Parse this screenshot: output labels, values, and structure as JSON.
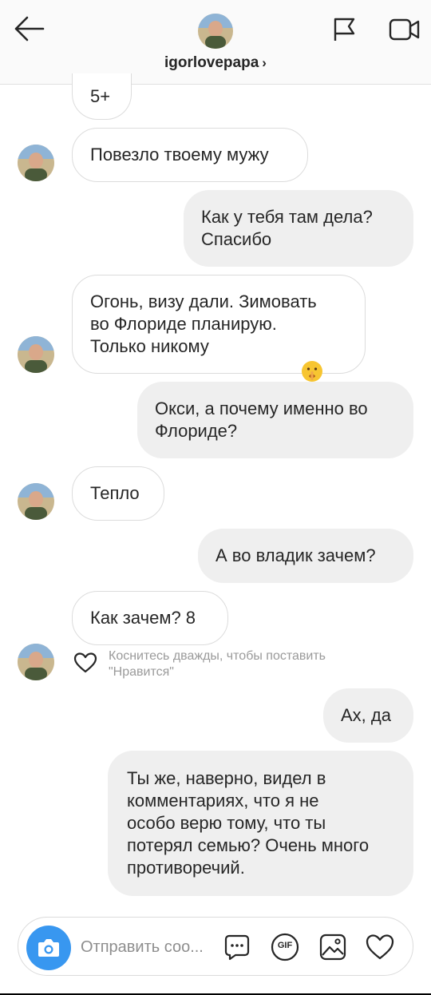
{
  "header": {
    "username": "igorlovepapa",
    "chevron": "›",
    "icons": [
      "back-arrow-icon",
      "flag-icon",
      "video-camera-icon"
    ]
  },
  "messages": [
    {
      "side": "in",
      "text": "5+"
    },
    {
      "side": "in",
      "text": "Повезло твоему мужу"
    },
    {
      "side": "out",
      "text": "Как у тебя там дела?\nСпасибо"
    },
    {
      "side": "in",
      "text": "Огонь, визу дали. Зимовать\nво Флориде планирую.\nТолько никому"
    },
    {
      "side": "out",
      "text": "Окси, а почему именно во\nФлориде?"
    },
    {
      "side": "in",
      "text": "Тепло"
    },
    {
      "side": "out",
      "text": "А во владик зачем?"
    },
    {
      "side": "in",
      "text": "Как зачем? 8"
    },
    {
      "side": "out",
      "text": "Ах, да"
    },
    {
      "side": "out",
      "text": "Ты же, наверно, видел в\nкомментариях, что я не\nособо верю тому, что ты\nпотерял семью? Очень много\nпротиворечий."
    }
  ],
  "like_hint": "Коснитесь дважды, чтобы поставить\n\"Нравится\"",
  "emoji": "shushing-face-emoji",
  "composer": {
    "placeholder": "Отправить соо...",
    "icons": [
      "camera-icon",
      "sticker-icon",
      "gif-icon",
      "gallery-icon",
      "heart-icon"
    ],
    "gif_label": "GIF"
  },
  "colors": {
    "accent": "#3897f0",
    "bubble_out": "#efefef",
    "bubble_in_border": "#dcdcdc",
    "hint_text": "#9a9a9a"
  }
}
